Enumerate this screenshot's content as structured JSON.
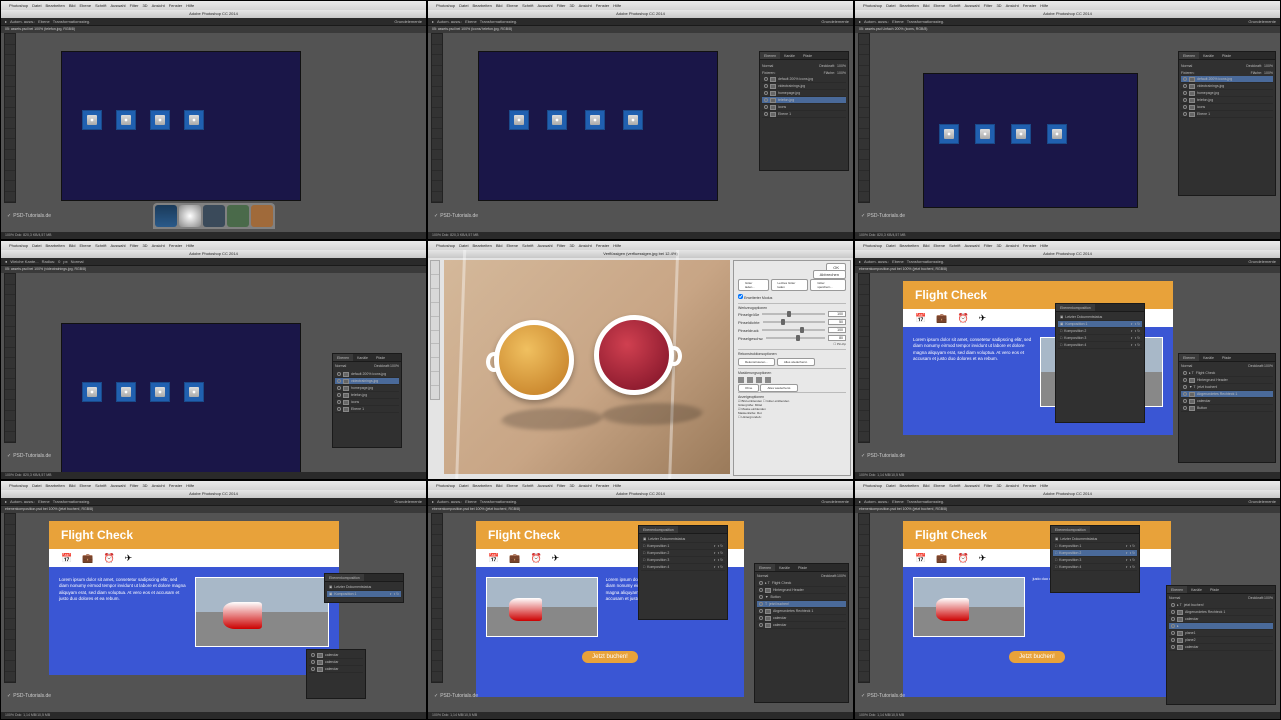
{
  "app_name": "Photoshop",
  "app_title": "Adobe Photoshop CC 2014",
  "menu": [
    "Photoshop",
    "Datei",
    "Bearbeiten",
    "Bild",
    "Ebene",
    "Schrift",
    "Auswahl",
    "Filter",
    "3D",
    "Ansicht",
    "Fenster",
    "Hilfe"
  ],
  "watermark": "PSD-Tutorials.de",
  "documents": {
    "assets": "05: assets.psd bei 100% (telefon.jpg, RGB/8)",
    "assets_icons": "05: assets.psd bei 100% (icons/ telefon.jpg, RGB/8)",
    "assets_unfach": "05: assets.psd Unfach 200% (icons, RGB/8)",
    "assets_video": "05: assets.psd bei 100% (videotrainings.jpg, RGB/8)",
    "liquify": "Verflüssigen (verfluessigen.jpg bei 12.4%)",
    "comp": "ebenenkomposition.psd bei 100% (jetzt buchen!, RGB/8)"
  },
  "panels": {
    "layers_tab": "Ebenen",
    "channels_tab": "Kanäle",
    "paths_tab": "Pfade",
    "comp_tab": "Ebenenkomposition",
    "opacity_label": "Deckkraft:",
    "fill_label": "Fläche:",
    "pct100": "100%",
    "blend_normal": "Normal",
    "lock_label": "Fixieren:",
    "layer_names": [
      "default 200% icons.jpg",
      "videotrainings.jpg",
      "homepage.jpg",
      "telefon.jpg",
      "icons",
      "Ebene 1"
    ],
    "comp_items": [
      "Letzter Dokumentstatus",
      "Komposition 1",
      "Komposition 2",
      "Komposition 3",
      "Komposition 4"
    ],
    "fc_layers": [
      "Flight Check",
      "Hintergrund Header",
      "jetzt buchen!",
      "Abgerundetes Rechteck 1",
      "calendar",
      "Button",
      "plane1",
      "plane2",
      "Group"
    ]
  },
  "dialog": {
    "ok": "OK",
    "cancel": "Abbrechen",
    "load_grid": "Gitter laden...",
    "save_grid": "Letztes Gitter laden",
    "save_grid2": "Gitter speichern...",
    "tool_options": "Werkzeugoptionen",
    "brush_size": "Pinselgröße",
    "brush_size_v": "100",
    "brush_density": "Pinseldichte",
    "brush_density_v": "50",
    "brush_pressure": "Pinseldruck",
    "brush_pressure_v": "100",
    "brush_rate": "Pinselgeschw.",
    "brush_rate_v": "80",
    "reconstruct": "Rekonstruktionsoptionen",
    "recon_btn": "Rekonstruieren...",
    "restore_btn": "Alles wiederherst.",
    "mask_opts": "Maskierungsoptionen",
    "none": "Ohne",
    "mesh_opts": "Anzeigeoptionen",
    "show_image": "Bild einblenden",
    "show_mesh": "Gitter einblenden",
    "mesh_size_l": "Gittergröße:",
    "mesh_size_v": "Mittel",
    "mesh_color_l": "Maskenfarbe:",
    "mesh_color_v": "Rot",
    "bg_l": "Hintergrundeb.:",
    "advanced": "Erweiterter Modus",
    "pin_edges": "Pin-Kp"
  },
  "design": {
    "title": "Flight Check",
    "button": "Jetzt buchen!",
    "lorem": "Lorem ipsum dolor sit amet, consetetur sadipscing elitr, sed diam nonumy eirmod tempor invidunt ut labore et dolore magna aliquyam erat, sed diam voluptua. At vero eos et accusam et justo duo dolores et ea rebum."
  },
  "status": {
    "zoom100": "100%",
    "docsize1": "Dok: 820,3 KB/4,57 MB",
    "docsize2": "Dok: 820,3 KB/4,57 MB",
    "docsize3": "Dok: 1,14 MB/10,5 MB"
  },
  "optbar": {
    "autoselect": "Autom. ausw.:",
    "layer": "Ebene",
    "transform": "Transformationssteg.",
    "essentials": "Grundelemente",
    "refine": "Weiche Kante...",
    "radius": "Radius:",
    "normal": "Normal"
  }
}
